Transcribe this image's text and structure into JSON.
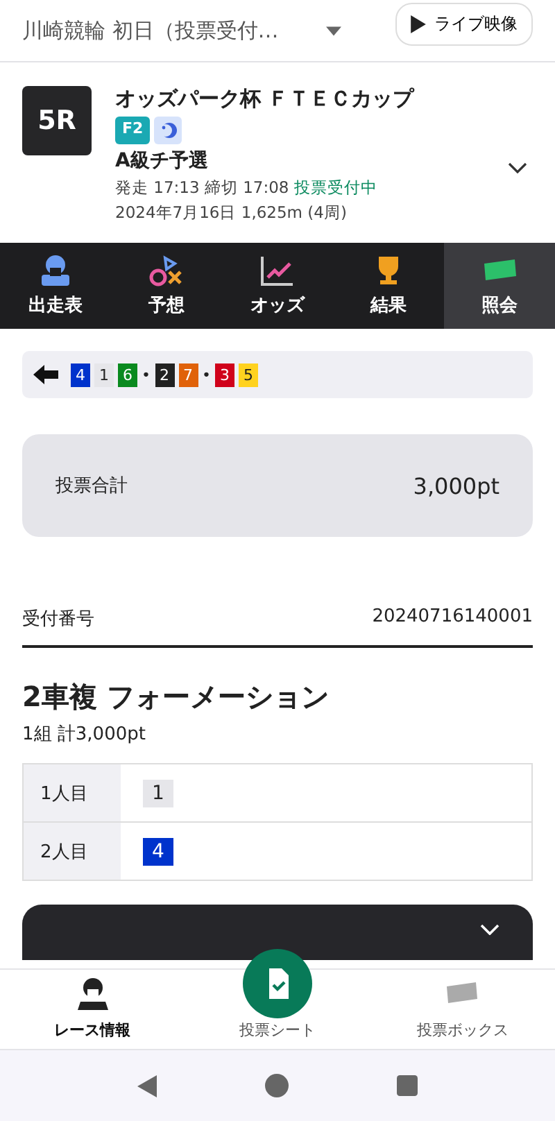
{
  "header": {
    "title": "川崎競輪 初日（投票受付…",
    "live_button": "ライブ映像"
  },
  "race": {
    "number": "5R",
    "name": "オッズパーク杯 ＦＴＥＣカップ",
    "grade": "F2",
    "night": true,
    "class": "A級チ予選",
    "schedule": "発走 17:13 締切 17:08",
    "status": "投票受付中",
    "details": "2024年7月16日 1,625m (4周)",
    "expanded": false
  },
  "tabs": [
    {
      "label": "出走表",
      "selected": false
    },
    {
      "label": "予想",
      "selected": false
    },
    {
      "label": "オッズ",
      "selected": false
    },
    {
      "label": "結果",
      "selected": false
    },
    {
      "label": "照会",
      "selected": true
    }
  ],
  "lineup": [
    {
      "kind": "num",
      "text": "4",
      "color": "#0033cc"
    },
    {
      "kind": "num",
      "text": "1",
      "color": "#e6e6ea"
    },
    {
      "kind": "num",
      "text": "6",
      "color": "#0a8a1f"
    },
    {
      "kind": "sep",
      "text": "•"
    },
    {
      "kind": "num",
      "text": "2",
      "color": "#222222"
    },
    {
      "kind": "num",
      "text": "7",
      "color": "#e0620a"
    },
    {
      "kind": "sep",
      "text": "•"
    },
    {
      "kind": "num",
      "text": "3",
      "color": "#d0021b"
    },
    {
      "kind": "num",
      "text": "5",
      "color": "#ffd21f"
    }
  ],
  "total": {
    "label": "投票合計",
    "value": "3,000pt"
  },
  "receipt": {
    "label": "受付番号",
    "value": "20240716140001"
  },
  "bet": {
    "title": "2車複 フォーメーション",
    "summary": "1組 計3,000pt",
    "rows": [
      {
        "label": "1人目",
        "numbers": [
          {
            "text": "1",
            "color": "#e6e6ea"
          }
        ]
      },
      {
        "label": "2人目",
        "numbers": [
          {
            "text": "4",
            "color": "#0033cc"
          }
        ]
      }
    ]
  },
  "bottom_nav": [
    {
      "label": "レース情報",
      "selected": true,
      "kind": "rider"
    },
    {
      "label": "投票シート",
      "selected": false,
      "kind": "sheet"
    },
    {
      "label": "投票ボックス",
      "selected": false,
      "kind": "ticket"
    }
  ]
}
